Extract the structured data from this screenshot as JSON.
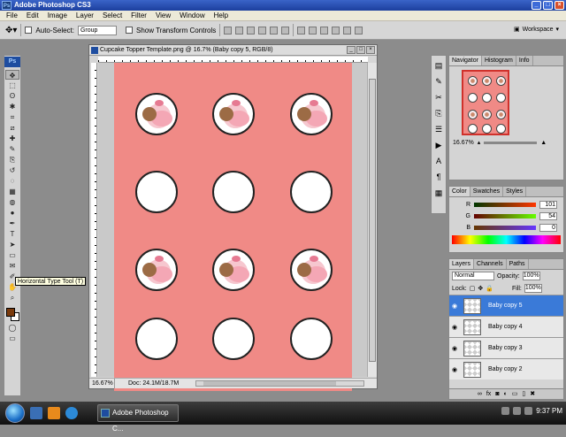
{
  "app": {
    "title": "Adobe Photoshop CS3"
  },
  "menu": [
    "File",
    "Edit",
    "Image",
    "Layer",
    "Select",
    "Filter",
    "View",
    "Window",
    "Help"
  ],
  "options": {
    "auto_select_label": "Auto-Select:",
    "auto_select_value": "Group",
    "show_transform_label": "Show Transform Controls",
    "workspace_label": "Workspace"
  },
  "toolbox": {
    "logo": "Ps",
    "tools": [
      "move-tool-icon",
      "marquee-tool-icon",
      "lasso-tool-icon",
      "magic-wand-icon",
      "crop-tool-icon",
      "slice-tool-icon",
      "healing-brush-icon",
      "brush-tool-icon",
      "clone-stamp-icon",
      "history-brush-icon",
      "eraser-tool-icon",
      "gradient-tool-icon",
      "blur-tool-icon",
      "dodge-tool-icon",
      "pen-tool-icon",
      "type-tool-icon",
      "path-select-icon",
      "shape-tool-icon",
      "notes-tool-icon",
      "eyedropper-tool-icon",
      "hand-tool-icon",
      "zoom-tool-icon"
    ],
    "tooltip": "Horizontal Type Tool (T)",
    "fg_color": "#7a3a0c",
    "bg_color": "#ffffff"
  },
  "document": {
    "title": "Cupcake Topper Template.png @ 16.7% (Baby copy 5, RGB/8)",
    "zoom": "16.67%",
    "doc_size": "Doc: 24.1M/18.7M",
    "page_color": "#f08a86",
    "circle_rows": [
      [
        "photo",
        "photo",
        "photo"
      ],
      [
        "blank",
        "blank",
        "blank"
      ],
      [
        "photo",
        "photo",
        "photo"
      ],
      [
        "blank",
        "blank",
        "blank"
      ]
    ]
  },
  "navigator": {
    "tabs": [
      "Navigator",
      "Histogram",
      "Info"
    ],
    "zoom": "16.67%"
  },
  "color": {
    "tabs": [
      "Color",
      "Swatches",
      "Styles"
    ],
    "r": {
      "label": "R",
      "value": "101"
    },
    "g": {
      "label": "G",
      "value": "54"
    },
    "b": {
      "label": "B",
      "value": "0"
    }
  },
  "layers": {
    "tabs": [
      "Layers",
      "Channels",
      "Paths"
    ],
    "blend_mode": "Normal",
    "opacity_label": "Opacity:",
    "opacity": "100%",
    "lock_label": "Lock:",
    "fill_label": "Fill:",
    "fill": "100%",
    "items": [
      "Baby copy 5",
      "Baby copy 4",
      "Baby copy 3",
      "Baby copy 2"
    ]
  },
  "taskbar": {
    "task_label": "Adobe Photoshop C...",
    "clock": "9:37 PM"
  }
}
